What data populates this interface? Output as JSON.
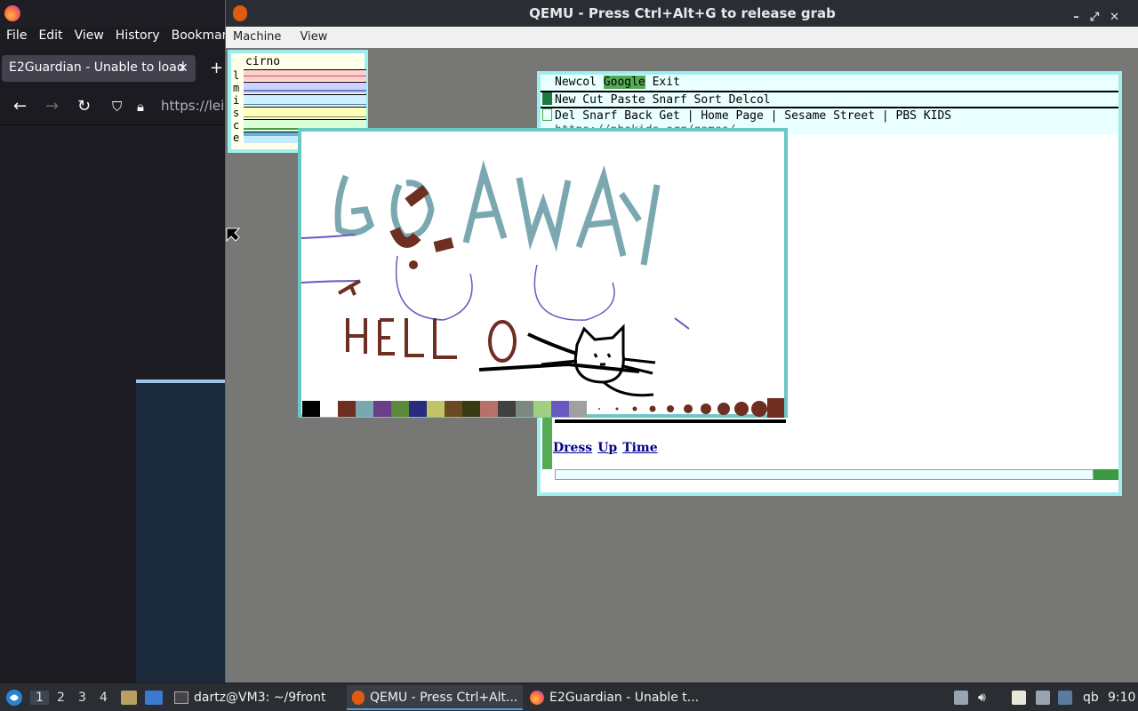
{
  "firefox": {
    "menu": [
      "File",
      "Edit",
      "View",
      "History",
      "Bookmarks"
    ],
    "tab_title": "E2Guardian - Unable to load",
    "url": "https://leig"
  },
  "qemu": {
    "title": "QEMU - Press Ctrl+Alt+G to release grab",
    "menu": [
      "Machine",
      "View"
    ]
  },
  "stats": {
    "name": "cirno",
    "labels": [
      "l",
      "m",
      "i",
      "s",
      "c",
      "e"
    ]
  },
  "acme": {
    "col_tag": [
      "Newcol",
      "Google",
      "Exit"
    ],
    "win_tag": "New Cut Paste Snarf Sort Delcol",
    "page_tag": "Del Snarf Back Get | Home Page | Sesame Street | PBS KIDS",
    "url_partial": "https://pbskids.org/games/",
    "links": [
      "Dress",
      "Up",
      "Time"
    ]
  },
  "paint": {
    "text_go_away": "GO AWAY",
    "text_hello": "HELLO",
    "palette": [
      "#000000",
      "#ffffff",
      "#6e2e22",
      "#7ba8b0",
      "#6a3f8a",
      "#5a8a3a",
      "#2a2a80",
      "#c2c46a",
      "#6a4a20",
      "#3a3a10",
      "#b8706a",
      "#404040",
      "#7a8a80",
      "#a0d080",
      "#6a58c0",
      "#a0a0a0"
    ]
  },
  "taskbar": {
    "workspaces": [
      "1",
      "2",
      "3",
      "4"
    ],
    "apps": [
      {
        "label": "dartz@VM3: ~/9front"
      },
      {
        "label": "QEMU - Press Ctrl+Alt..."
      },
      {
        "label": "E2Guardian - Unable t..."
      }
    ],
    "clock": "9:10",
    "tray_text": "qb"
  }
}
